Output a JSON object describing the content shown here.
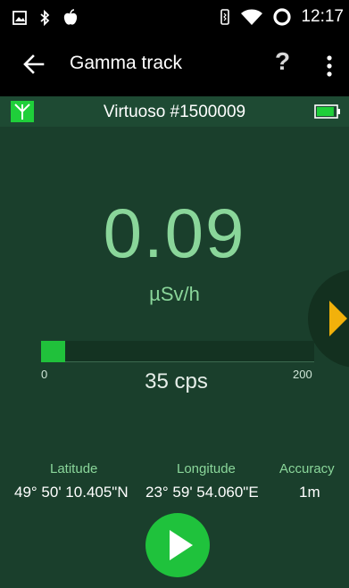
{
  "statusbar": {
    "time": "12:17",
    "icons": [
      "image-notification-icon",
      "bluetooth-icon",
      "apple-notification-icon",
      "vibrate-icon",
      "wifi-icon",
      "ring-status-icon"
    ]
  },
  "appbar": {
    "title": "Gamma track",
    "help_label": "?"
  },
  "device": {
    "name": "Virtuoso #1500009",
    "battery_level": 0.9
  },
  "reading": {
    "dose_rate": "0.09",
    "unit": "µSv/h",
    "count_rate_label": "35 cps",
    "count_rate": 35,
    "bar_min": "0",
    "bar_max": "200"
  },
  "location": {
    "latitude_label": "Latitude",
    "longitude_label": "Longitude",
    "accuracy_label": "Accuracy",
    "latitude": "49° 50' 10.405\"N",
    "longitude": "23° 59' 54.060\"E",
    "accuracy": "1m"
  },
  "colors": {
    "accent_green": "#1fc23c",
    "reading_green": "#8ad69a",
    "panel_background": "#1a3f2c",
    "side_arrow": "#f2b10b"
  }
}
